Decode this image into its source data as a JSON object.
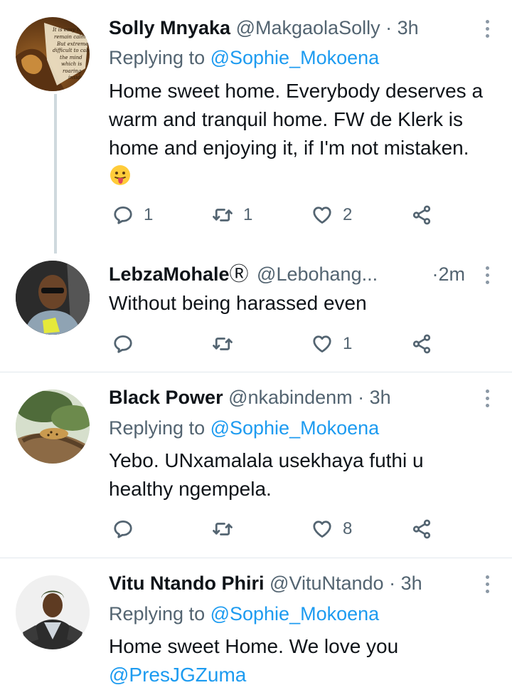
{
  "tweets": [
    {
      "name": "Solly Mnyaka",
      "handle": "@MakgaolaSolly",
      "dot": "·",
      "time": "3h",
      "replying_prefix": "Replying to ",
      "replying_to": "@Sophie_Mokoena",
      "text": "Home sweet home. Everybody deserves a warm and tranquil home. FW de Klerk is home and enjoying it, if I'm not mistaken.",
      "emoji": "tongue-out-face",
      "avatar_text": "It is easy to remain calm But extremely difficult to calm the mind which is roaring inside",
      "replies": "1",
      "retweets": "1",
      "likes": "2"
    },
    {
      "name": "LebzaMohale",
      "verified_mark": "Ⓡ",
      "handle": "@Lebohang...",
      "dot": "·",
      "time": "2m",
      "text": "Without being harassed even",
      "replies": "",
      "retweets": "",
      "likes": "1"
    },
    {
      "name": "Black Power",
      "handle": "@nkabindenm",
      "dot": "·",
      "time": "3h",
      "replying_prefix": "Replying to ",
      "replying_to": "@Sophie_Mokoena",
      "text": "Yebo. UNxamalala usekhaya futhi u healthy ngempela.",
      "replies": "",
      "retweets": "",
      "likes": "8"
    },
    {
      "name": "Vitu Ntando Phiri",
      "handle": "@VituNtando",
      "dot": "·",
      "time": "3h",
      "replying_prefix": "Replying to ",
      "replying_to": "@Sophie_Mokoena",
      "text_1": "Home sweet Home. We love you",
      "text_mention": "@PresJGZuma"
    }
  ],
  "icons": {
    "reply": "reply-icon",
    "retweet": "retweet-icon",
    "like": "heart-icon",
    "share": "share-icon",
    "more": "more-icon"
  },
  "colors": {
    "link": "#1d9bf0",
    "secondary_text": "#536471",
    "divider": "#e1e8ed",
    "thread_line": "#cfd9de"
  }
}
